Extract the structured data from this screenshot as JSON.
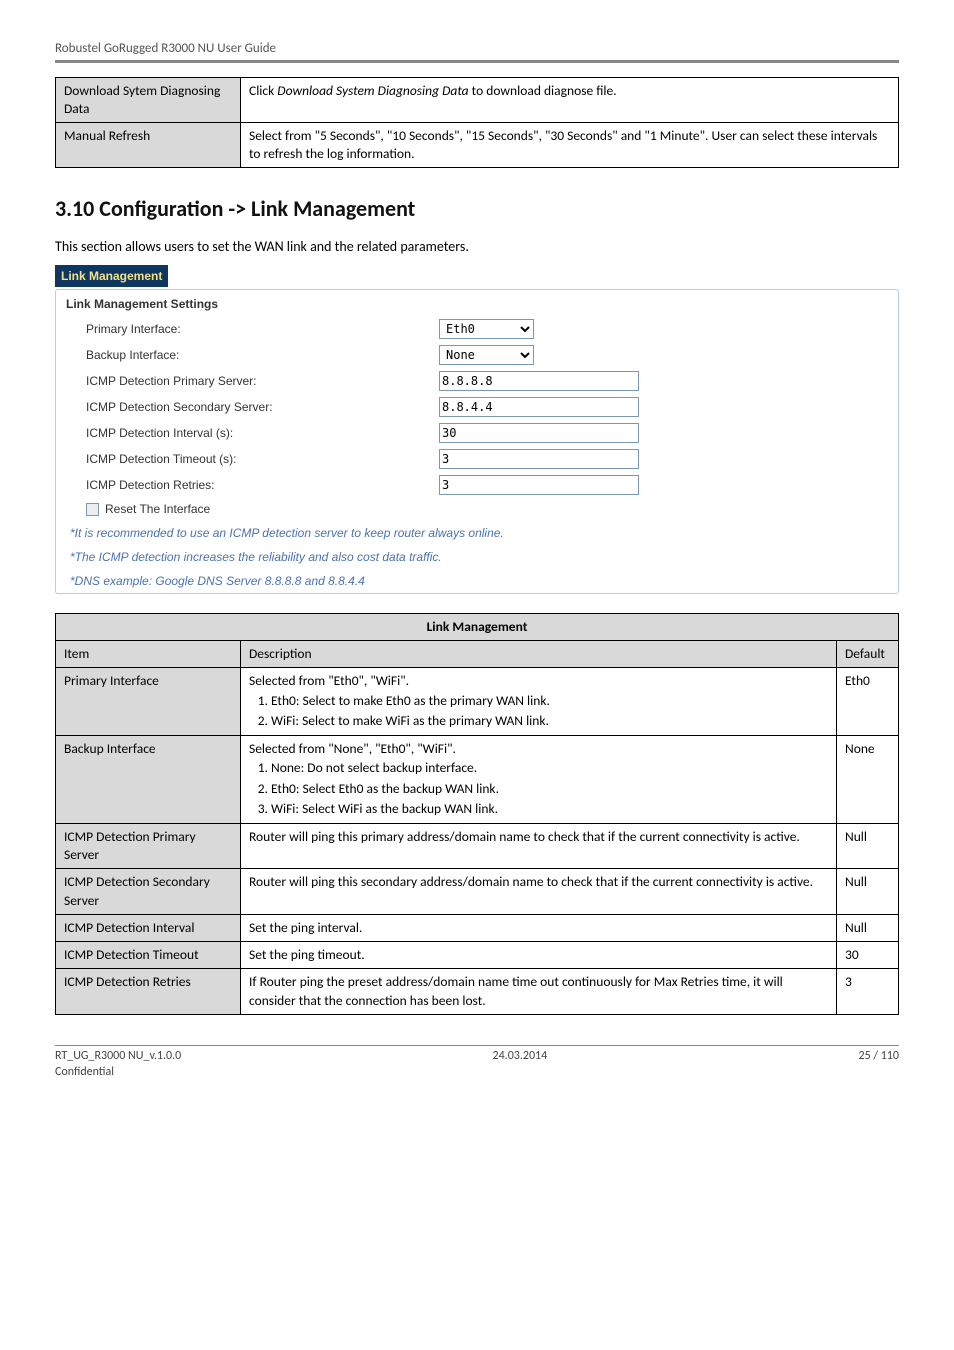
{
  "header": {
    "doc_title": "Robustel GoRugged R3000 NU User Guide"
  },
  "table1": {
    "rows": [
      {
        "item": "Download Sytem Diagnosing Data",
        "desc_parts": [
          "Click ",
          "Download System Diagnosing Data",
          " to download diagnose file."
        ]
      },
      {
        "item": "Manual Refresh",
        "desc": "Select from \"5 Seconds\", \"10 Seconds\", \"15 Seconds\", \"30 Seconds\" and \"1 Minute\". User can select these intervals to refresh the log information."
      }
    ]
  },
  "section": {
    "heading": "3.10  Configuration -> Link Management",
    "intro": "This section allows users to set the WAN link and the related parameters."
  },
  "screenshot": {
    "panel_title": "Link Management",
    "box_title": "Link Management Settings",
    "fields": {
      "primary_iface": {
        "label": "Primary Interface:",
        "value": "Eth0"
      },
      "backup_iface": {
        "label": "Backup Interface:",
        "value": "None"
      },
      "icmp_primary": {
        "label": "ICMP Detection Primary Server:",
        "value": "8.8.8.8"
      },
      "icmp_secondary": {
        "label": "ICMP Detection Secondary Server:",
        "value": "8.8.4.4"
      },
      "icmp_interval": {
        "label": "ICMP Detection Interval (s):",
        "value": "30"
      },
      "icmp_timeout": {
        "label": "ICMP Detection Timeout (s):",
        "value": "3"
      },
      "icmp_retries": {
        "label": "ICMP Detection Retries:",
        "value": "3"
      },
      "reset_iface": {
        "label": "Reset The Interface"
      }
    },
    "notes": [
      "*It is recommended to use an ICMP detection server to keep router always online.",
      "*The ICMP detection increases the reliability and also cost data traffic.",
      "*DNS example: Google DNS Server 8.8.8.8 and 8.8.4.4"
    ]
  },
  "table2": {
    "caption": "Link Management",
    "head": {
      "item": "Item",
      "desc": "Description",
      "def": "Default"
    },
    "rows": [
      {
        "item": "Primary Interface",
        "desc_intro": "Selected from \"Eth0\", \"WiFi\".",
        "list": [
          "Eth0: Select to make Eth0 as the primary WAN link.",
          "WiFi: Select to make WiFi as the primary WAN link."
        ],
        "def": "Eth0"
      },
      {
        "item": "Backup Interface",
        "desc_intro": "Selected from \"None\", \"Eth0\", \"WiFi\".",
        "list": [
          "None: Do not select backup interface.",
          "Eth0: Select Eth0 as the backup WAN link.",
          "WiFi: Select WiFi as the backup WAN link."
        ],
        "def": "None"
      },
      {
        "item": "ICMP Detection Primary Server",
        "desc": "Router will ping this primary address/domain name to check that if the current connectivity is active.",
        "def": "Null"
      },
      {
        "item": "ICMP Detection Secondary Server",
        "desc": "Router will ping this secondary address/domain name to check that if the current connectivity is active.",
        "def": "Null"
      },
      {
        "item": "ICMP Detection Interval",
        "desc": "Set the ping interval.",
        "def": "Null"
      },
      {
        "item": "ICMP Detection Timeout",
        "desc": "Set the ping timeout.",
        "def": "30"
      },
      {
        "item": "ICMP Detection Retries",
        "desc": "If Router ping the preset address/domain name time out continuously for Max Retries time, it will consider that the connection has been lost.",
        "def": "3"
      }
    ]
  },
  "footer": {
    "left": "RT_UG_R3000 NU_v.1.0.0",
    "center": "24.03.2014",
    "right": "25 / 110",
    "conf": "Confidential"
  }
}
